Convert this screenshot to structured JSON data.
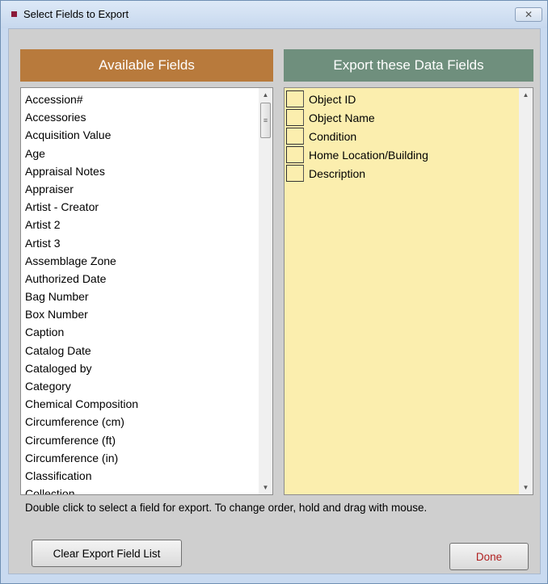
{
  "window": {
    "title": "Select Fields to Export",
    "close_glyph": "✕",
    "icon": "app-icon"
  },
  "available": {
    "header": "Available Fields",
    "items": [
      "Accession#",
      "Accessories",
      "Acquisition Value",
      "Age",
      "Appraisal Notes",
      "Appraiser",
      "Artist - Creator",
      "Artist 2",
      "Artist 3",
      "Assemblage Zone",
      "Authorized Date",
      "Bag Number",
      "Box Number",
      "Caption",
      "Catalog Date",
      "Cataloged by",
      "Category",
      "Chemical Composition",
      "Circumference (cm)",
      "Circumference (ft)",
      "Circumference (in)",
      "Classification",
      "Collection"
    ]
  },
  "export": {
    "header": "Export these Data Fields",
    "items": [
      "Object ID",
      "Object Name",
      "Condition",
      "Home Location/Building",
      "Description"
    ]
  },
  "scroll": {
    "up_glyph": "▲",
    "down_glyph": "▼",
    "thumb_glyph": "≡"
  },
  "hint_text": "Double click to select a field for export.  To change order, hold and drag with mouse.",
  "buttons": {
    "clear": "Clear Export Field List",
    "done": "Done"
  },
  "colors": {
    "available_header": "#b87a3c",
    "export_header": "#6f8f7d",
    "export_bg": "#fbeeae",
    "done_text": "#b02020"
  }
}
